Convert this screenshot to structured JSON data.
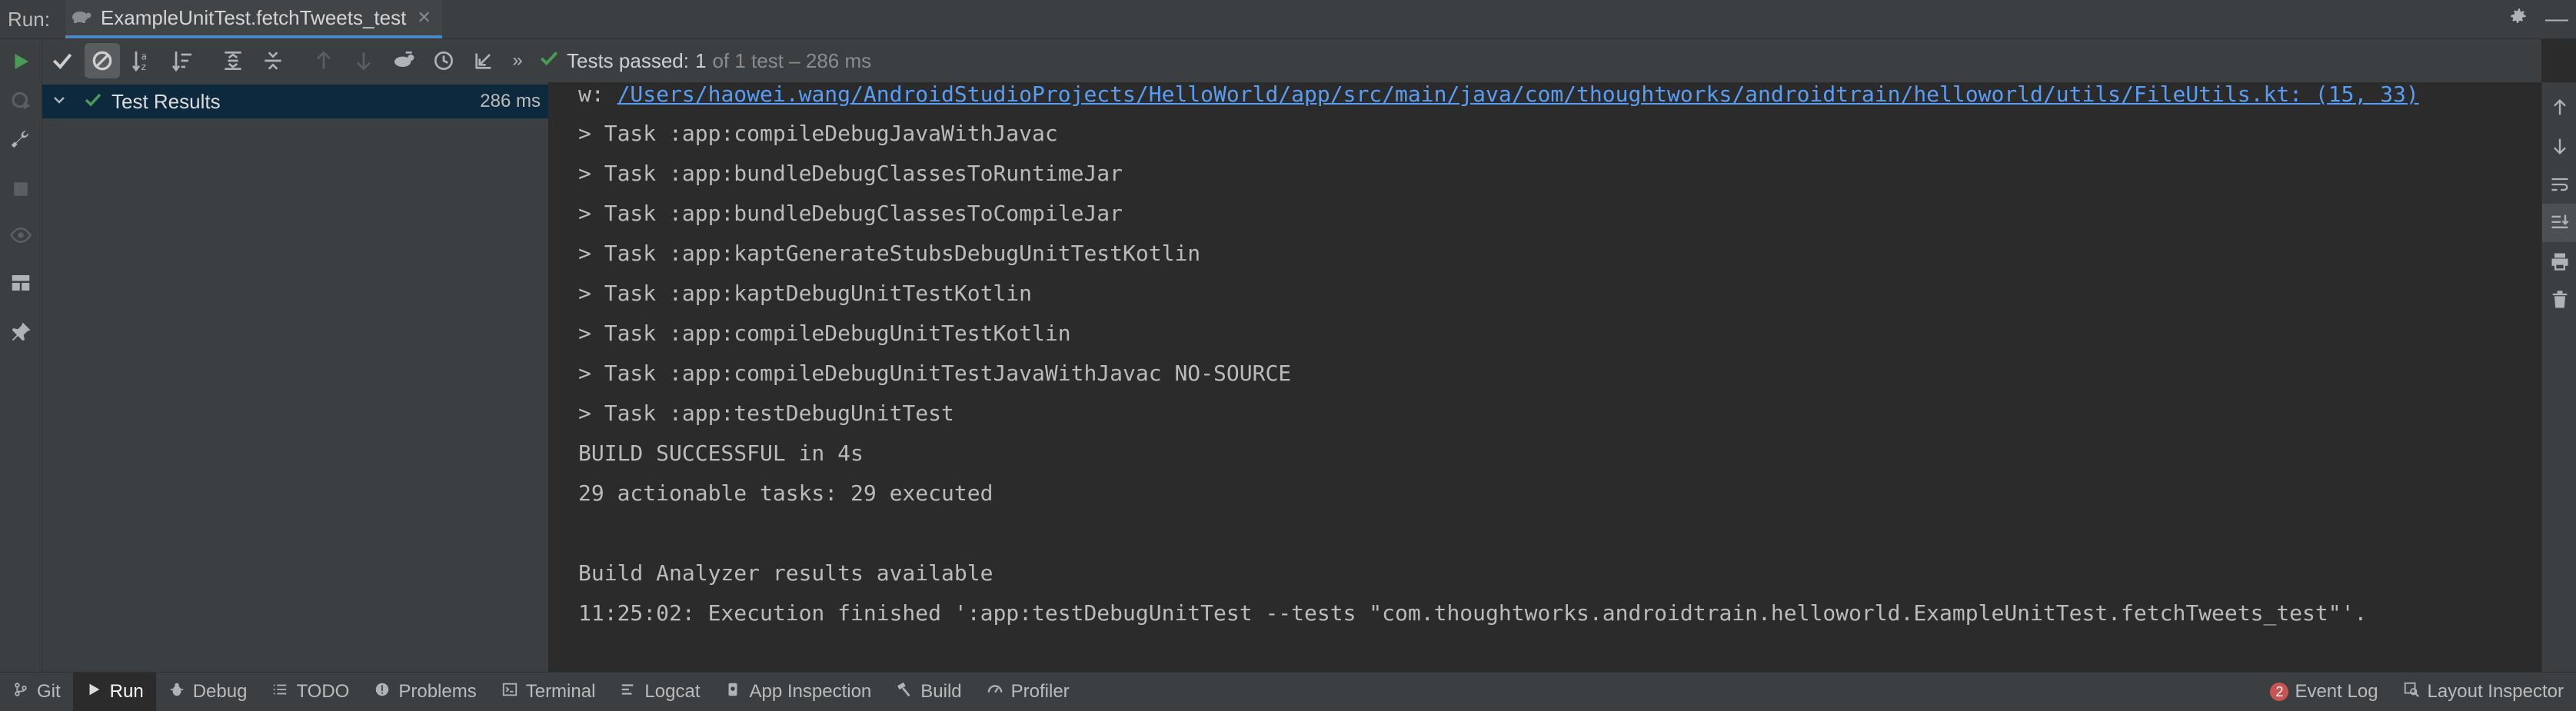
{
  "runbar": {
    "label": "Run:",
    "tab_title": "ExampleUnitTest.fetchTweets_test",
    "icons": [
      "gear-icon",
      "minimize-icon"
    ]
  },
  "test_toolbar": {
    "status_label": "Tests passed:",
    "status_count": "1",
    "status_rest": "of 1 test – 286 ms"
  },
  "tree": {
    "root_label": "Test Results",
    "root_duration": "286 ms"
  },
  "console": {
    "warn_prefix": "w: ",
    "warn_link": "/Users/haowei.wang/AndroidStudioProjects/HelloWorld/app/src/main/java/com/thoughtworks/androidtrain/helloworld/utils/FileUtils.kt: (15, 33)",
    "lines": [
      "> Task :app:compileDebugJavaWithJavac",
      "> Task :app:bundleDebugClassesToRuntimeJar",
      "> Task :app:bundleDebugClassesToCompileJar",
      "> Task :app:kaptGenerateStubsDebugUnitTestKotlin",
      "> Task :app:kaptDebugUnitTestKotlin",
      "> Task :app:compileDebugUnitTestKotlin",
      "> Task :app:compileDebugUnitTestJavaWithJavac NO-SOURCE",
      "> Task :app:testDebugUnitTest",
      "BUILD SUCCESSFUL in 4s",
      "29 actionable tasks: 29 executed",
      "",
      "Build Analyzer results available",
      "11:25:02: Execution finished ':app:testDebugUnitTest --tests \"com.thoughtworks.androidtrain.helloworld.ExampleUnitTest.fetchTweets_test\"'."
    ]
  },
  "bottombar": {
    "items": [
      {
        "label": "Git",
        "icon": "git-icon"
      },
      {
        "label": "Run",
        "icon": "run-icon"
      },
      {
        "label": "Debug",
        "icon": "debug-icon"
      },
      {
        "label": "TODO",
        "icon": "todo-icon"
      },
      {
        "label": "Problems",
        "icon": "problems-icon"
      },
      {
        "label": "Terminal",
        "icon": "terminal-icon"
      },
      {
        "label": "Logcat",
        "icon": "logcat-icon"
      },
      {
        "label": "App Inspection",
        "icon": "app-inspection-icon"
      },
      {
        "label": "Build",
        "icon": "build-icon"
      },
      {
        "label": "Profiler",
        "icon": "profiler-icon"
      }
    ],
    "event_log_count": "2",
    "event_log_label": "Event Log",
    "layout_inspector_label": "Layout Inspector"
  },
  "colors": {
    "accent": "#4a88c7",
    "success": "#499c54",
    "link": "#589df6",
    "badge": "#c75450",
    "background": "#2b2b2b",
    "panel": "#3c3f41"
  }
}
